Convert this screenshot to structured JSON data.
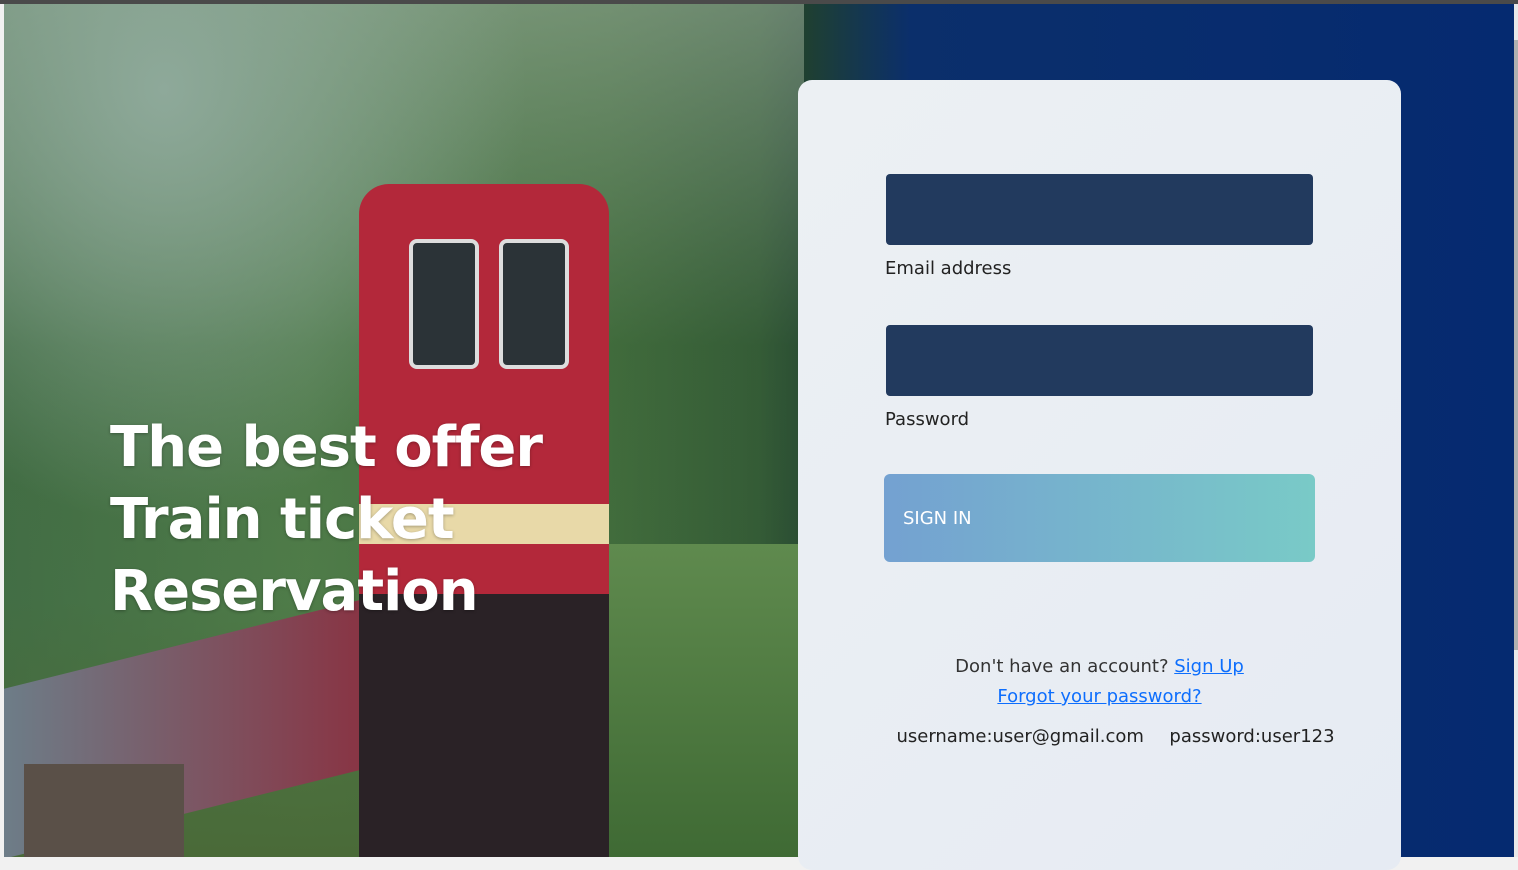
{
  "hero": {
    "title_lines": [
      "The best offer",
      "Train ticket",
      "Reservation"
    ]
  },
  "login": {
    "email_label": "Email address",
    "email_value": "",
    "password_label": "Password",
    "password_value": "",
    "signin_label": "SIGN IN",
    "no_account_text": "Don't have an account?",
    "signup_link": "Sign Up",
    "forgot_link": "Forgot your password?",
    "demo_username": "username:user@gmail.com",
    "demo_password": "password:user123"
  },
  "colors": {
    "input_bg": "#223a5e",
    "button_start": "#74a1d1",
    "button_end": "#79cac7",
    "link": "#0d6efd",
    "right_bg": "#052a70"
  }
}
